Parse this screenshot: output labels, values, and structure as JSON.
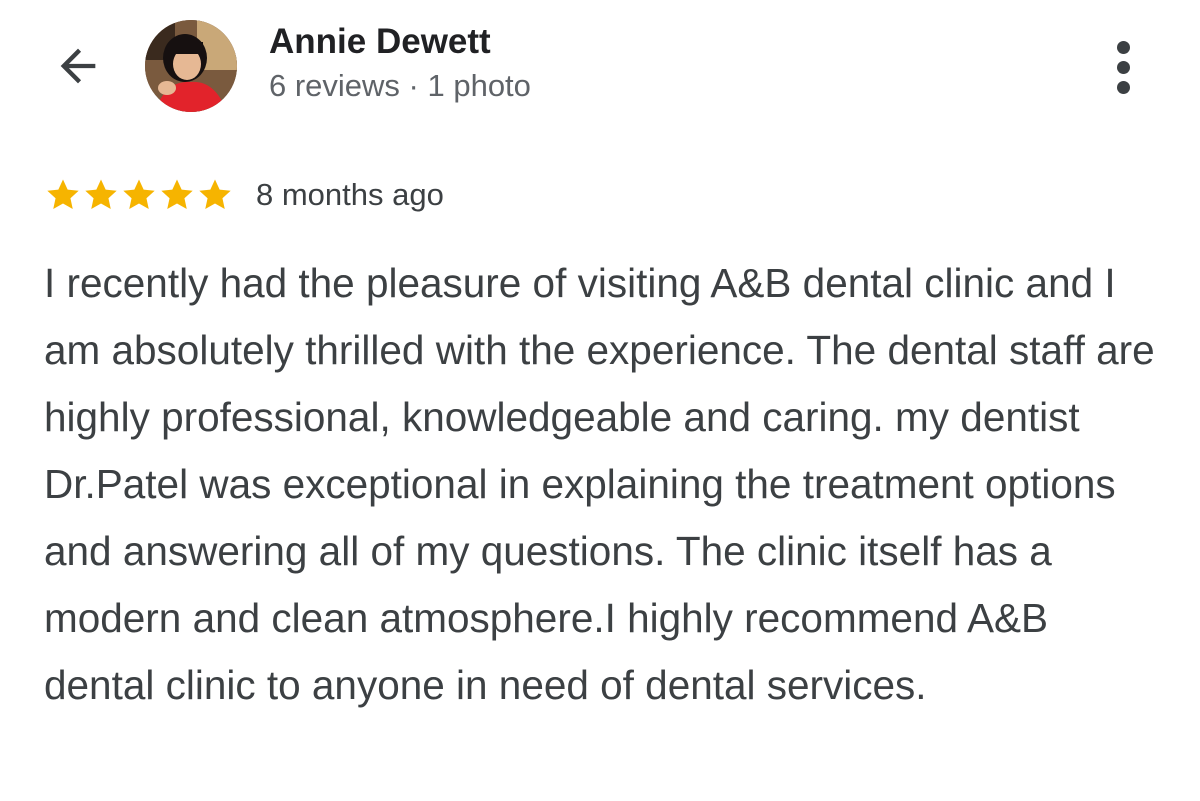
{
  "header": {
    "back_icon": "arrow-back-icon",
    "author": {
      "name": "Annie Dewett",
      "meta": "6 reviews · 1 photo"
    },
    "more_icon": "more-vert-icon"
  },
  "review": {
    "rating": 5,
    "rating_max": 5,
    "star_color": "#f6b400",
    "time": "8 months ago",
    "text": "I recently had the pleasure of visiting A&B dental clinic and I am absolutely thrilled with the experience. The dental staff are highly professional, knowledgeable and caring. my dentist Dr.Patel was exceptional in explaining the treatment options and answering all of my questions. The clinic itself has a modern and clean atmosphere.I highly recommend A&B dental clinic to anyone in need of dental services."
  }
}
